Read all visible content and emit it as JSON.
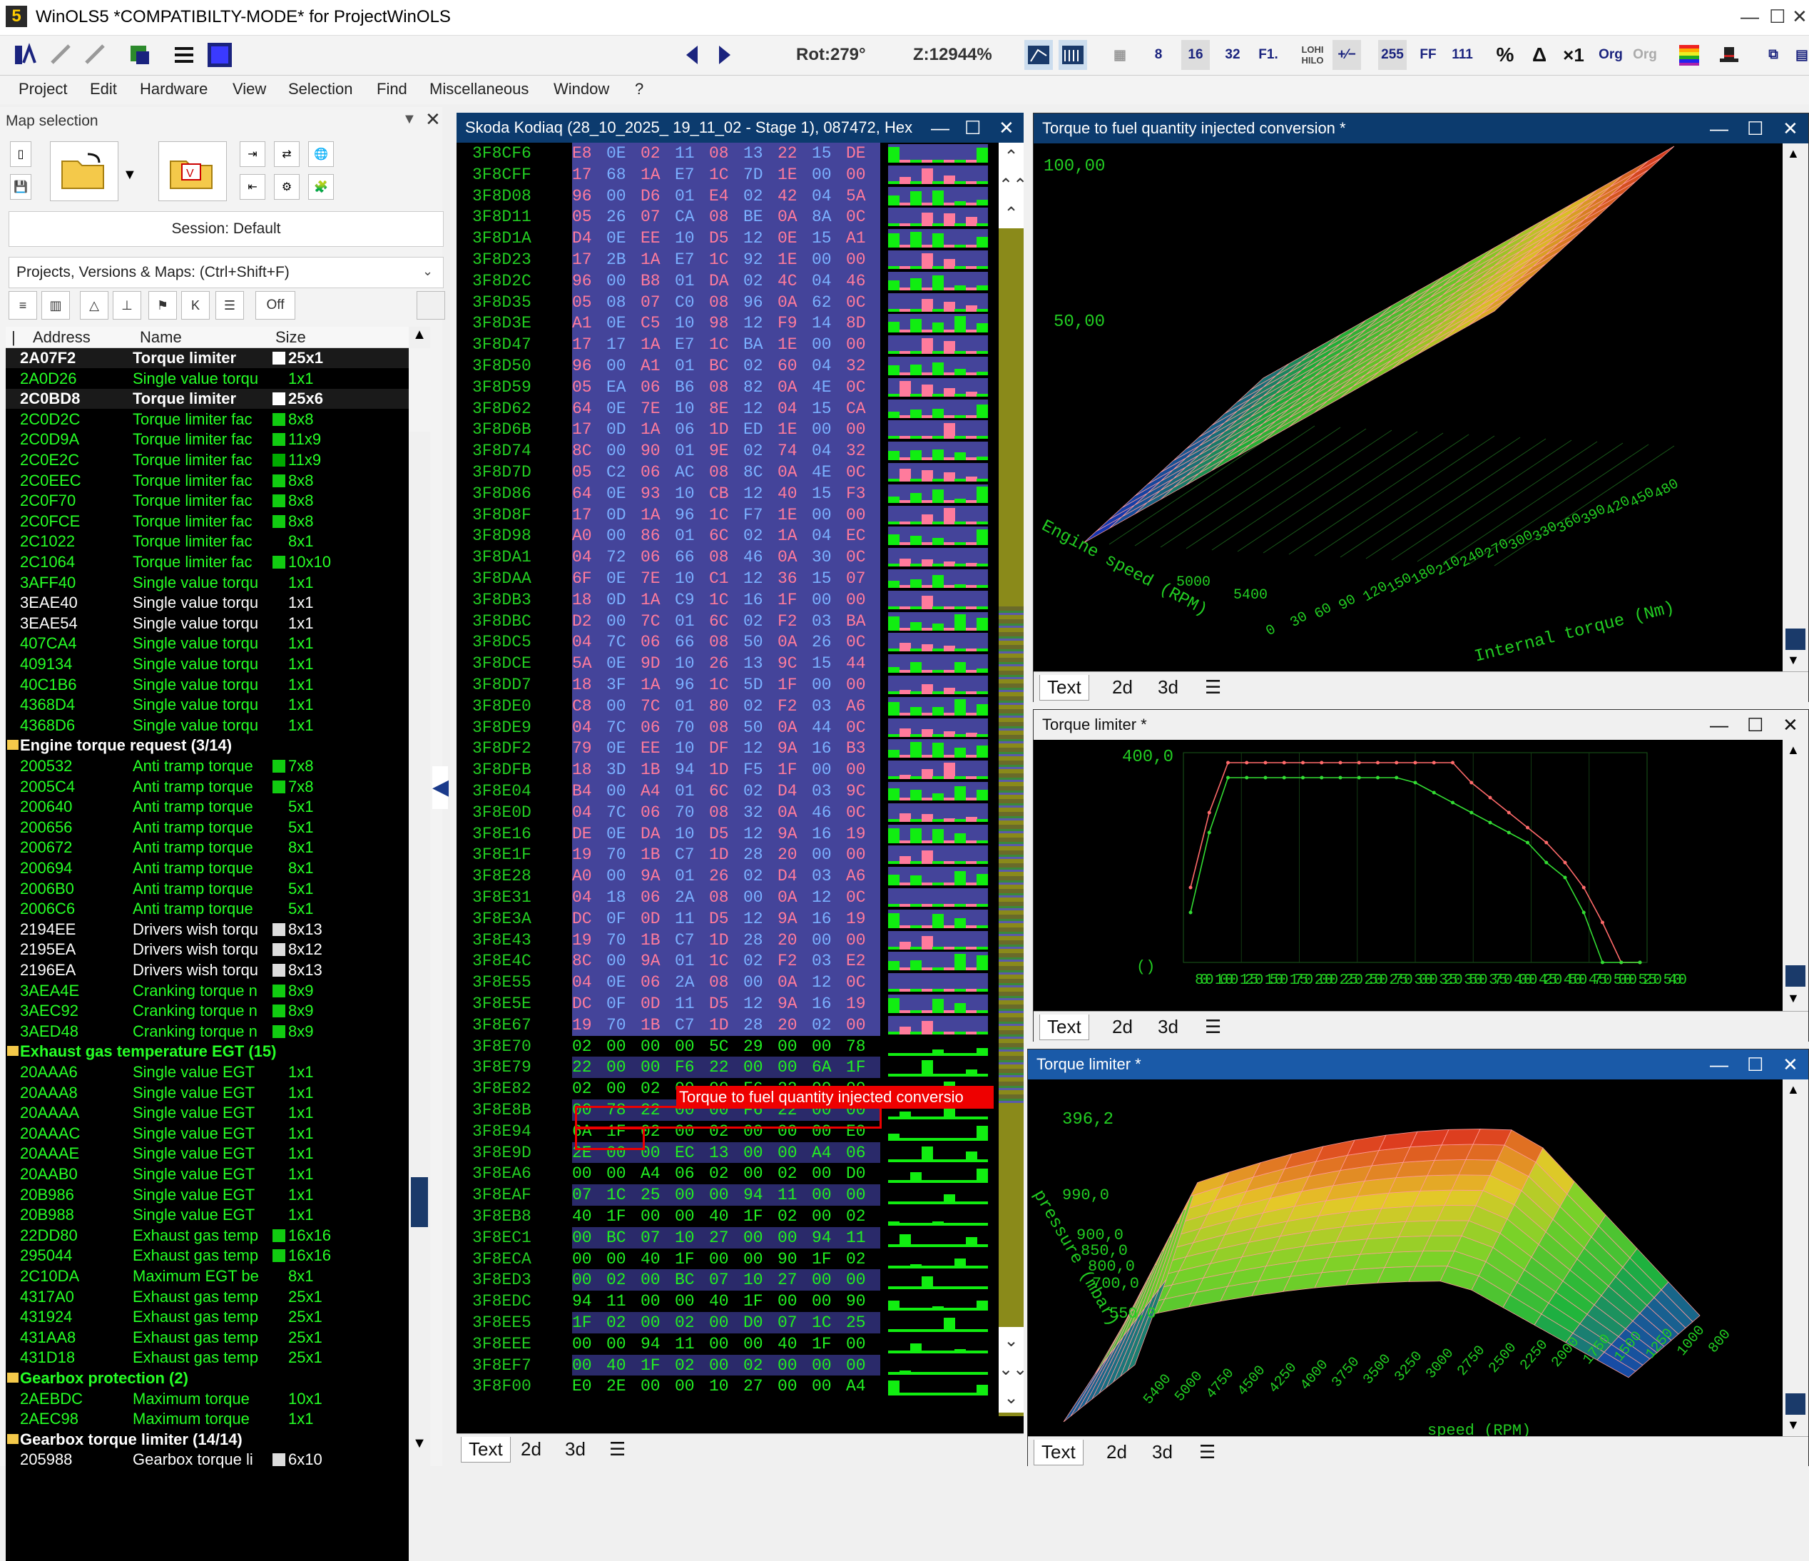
{
  "app": {
    "title": "WinOLS5 *COMPATIBILTY-MODE* for ProjectWinOLS",
    "logo": "5"
  },
  "toolbar": {
    "rot": "Rot:279°",
    "zoom": "Z:12944%",
    "btn8": "8",
    "btn16": "16",
    "btn32": "32",
    "btnf1": "F1.",
    "lohi": "LOHI",
    "hilo": "HILO",
    "b255": "255",
    "bff": "FF",
    "b111": "111",
    "pct": "%",
    "delta": "Δ",
    "x1": "×1",
    "org": "Org",
    "org2": "Org"
  },
  "menu": [
    "Project",
    "Edit",
    "Hardware",
    "View",
    "Selection",
    "Find",
    "Miscellaneous",
    "Window",
    "?"
  ],
  "map_selection": {
    "title": "Map selection",
    "session": "Session: Default",
    "search_placeholder": "Projects, Versions & Maps:  (Ctrl+Shift+F)",
    "off": "Off",
    "columns": {
      "address": "Address",
      "name": "Name",
      "size": "Size"
    },
    "rows": [
      {
        "t": "sel",
        "a": "2A07F2",
        "n": "Torque limiter",
        "s": "25x1",
        "sw": "#fff"
      },
      {
        "t": "g",
        "a": "2A0D26",
        "n": "Single value torqu",
        "s": "1x1"
      },
      {
        "t": "sel",
        "a": "2C0BD8",
        "n": "Torque limiter",
        "s": "25x6",
        "sw": "#fff"
      },
      {
        "t": "g",
        "a": "2C0D2C",
        "n": "Torque limiter fac",
        "s": "8x8",
        "sw": "#1c1"
      },
      {
        "t": "g",
        "a": "2C0D9A",
        "n": "Torque limiter fac",
        "s": "11x9",
        "sw": "#1c1"
      },
      {
        "t": "g",
        "a": "2C0E2C",
        "n": "Torque limiter fac",
        "s": "11x9",
        "sw": "#0a0"
      },
      {
        "t": "g",
        "a": "2C0EEC",
        "n": "Torque limiter fac",
        "s": "8x8",
        "sw": "#1c1"
      },
      {
        "t": "g",
        "a": "2C0F70",
        "n": "Torque limiter fac",
        "s": "8x8",
        "sw": "#1c1"
      },
      {
        "t": "g",
        "a": "2C0FCE",
        "n": "Torque limiter fac",
        "s": "8x8",
        "sw": "#1c1"
      },
      {
        "t": "g",
        "a": "2C1022",
        "n": "Torque limiter fac",
        "s": "8x1"
      },
      {
        "t": "g",
        "a": "2C1064",
        "n": "Torque limiter fac",
        "s": "10x10",
        "sw": "#1c1"
      },
      {
        "t": "g",
        "a": "3AFF40",
        "n": "Single value torqu",
        "s": "1x1"
      },
      {
        "t": "w",
        "a": "3EAE40",
        "n": "Single value torqu",
        "s": "1x1"
      },
      {
        "t": "w",
        "a": "3EAE54",
        "n": "Single value torqu",
        "s": "1x1"
      },
      {
        "t": "g",
        "a": "407CA4",
        "n": "Single value torqu",
        "s": "1x1"
      },
      {
        "t": "g",
        "a": "409134",
        "n": "Single value torqu",
        "s": "1x1"
      },
      {
        "t": "g",
        "a": "40C1B6",
        "n": "Single value torqu",
        "s": "1x1"
      },
      {
        "t": "g",
        "a": "4368D4",
        "n": "Single value torqu",
        "s": "1x1"
      },
      {
        "t": "g",
        "a": "4368D6",
        "n": "Single value torqu",
        "s": "1x1"
      },
      {
        "t": "grpw",
        "n": "Engine torque request (3/14)"
      },
      {
        "t": "g",
        "a": "200532",
        "n": "Anti tramp torque",
        "s": "7x8",
        "sw": "#1c1"
      },
      {
        "t": "g",
        "a": "2005C4",
        "n": "Anti tramp torque",
        "s": "7x8",
        "sw": "#1c1"
      },
      {
        "t": "g",
        "a": "200640",
        "n": "Anti tramp torque",
        "s": "5x1"
      },
      {
        "t": "g",
        "a": "200656",
        "n": "Anti tramp torque",
        "s": "5x1"
      },
      {
        "t": "g",
        "a": "200672",
        "n": "Anti tramp torque",
        "s": "8x1"
      },
      {
        "t": "g",
        "a": "200694",
        "n": "Anti tramp torque",
        "s": "8x1"
      },
      {
        "t": "g",
        "a": "2006B0",
        "n": "Anti tramp torque",
        "s": "5x1"
      },
      {
        "t": "g",
        "a": "2006C6",
        "n": "Anti tramp torque",
        "s": "5x1"
      },
      {
        "t": "w",
        "a": "2194EE",
        "n": "Drivers wish torqu",
        "s": "8x13",
        "sw": "#ddd"
      },
      {
        "t": "w",
        "a": "2195EA",
        "n": "Drivers wish torqu",
        "s": "8x12",
        "sw": "#ddd"
      },
      {
        "t": "w",
        "a": "2196EA",
        "n": "Drivers wish torqu",
        "s": "8x13",
        "sw": "#ddd"
      },
      {
        "t": "g",
        "a": "3AEA4E",
        "n": "Cranking torque n",
        "s": "8x9",
        "sw": "#1c1"
      },
      {
        "t": "g",
        "a": "3AEC92",
        "n": "Cranking torque n",
        "s": "8x9",
        "sw": "#1c1"
      },
      {
        "t": "g",
        "a": "3AED48",
        "n": "Cranking torque n",
        "s": "8x9",
        "sw": "#1c1"
      },
      {
        "t": "grp",
        "n": "Exhaust gas temperature EGT (15)"
      },
      {
        "t": "g",
        "a": "20AAA6",
        "n": "Single value EGT",
        "s": "1x1"
      },
      {
        "t": "g",
        "a": "20AAA8",
        "n": "Single value EGT",
        "s": "1x1"
      },
      {
        "t": "g",
        "a": "20AAAA",
        "n": "Single value EGT",
        "s": "1x1"
      },
      {
        "t": "g",
        "a": "20AAAC",
        "n": "Single value EGT",
        "s": "1x1"
      },
      {
        "t": "g",
        "a": "20AAAE",
        "n": "Single value EGT",
        "s": "1x1"
      },
      {
        "t": "g",
        "a": "20AAB0",
        "n": "Single value EGT",
        "s": "1x1"
      },
      {
        "t": "g",
        "a": "20B986",
        "n": "Single value EGT",
        "s": "1x1"
      },
      {
        "t": "g",
        "a": "20B988",
        "n": "Single value EGT",
        "s": "1x1"
      },
      {
        "t": "g",
        "a": "22DD80",
        "n": "Exhaust gas temp",
        "s": "16x16",
        "sw": "#1c1"
      },
      {
        "t": "g",
        "a": "295044",
        "n": "Exhaust gas temp",
        "s": "16x16",
        "sw": "#1c1"
      },
      {
        "t": "g",
        "a": "2C10DA",
        "n": "Maximum EGT be",
        "s": "8x1"
      },
      {
        "t": "g",
        "a": "4317A0",
        "n": "Exhaust gas temp",
        "s": "25x1"
      },
      {
        "t": "g",
        "a": "431924",
        "n": "Exhaust gas temp",
        "s": "25x1"
      },
      {
        "t": "g",
        "a": "431AA8",
        "n": "Exhaust gas temp",
        "s": "25x1"
      },
      {
        "t": "g",
        "a": "431D18",
        "n": "Exhaust gas temp",
        "s": "25x1"
      },
      {
        "t": "grp",
        "n": "Gearbox protection (2)"
      },
      {
        "t": "g",
        "a": "2AEBDC",
        "n": "Maximum torque",
        "s": "10x1"
      },
      {
        "t": "g",
        "a": "2AEC98",
        "n": "Maximum torque",
        "s": "1x1"
      },
      {
        "t": "grpw",
        "n": "Gearbox torque limiter (14/14)"
      },
      {
        "t": "w",
        "a": "205988",
        "n": "Gearbox torque li",
        "s": "6x10",
        "sw": "#ddd"
      }
    ]
  },
  "hex": {
    "title": "Skoda Kodiaq (28_10_2025_ 19_11_02 - Stage 1), 087472, Hex",
    "tooltip": "Torque to fuel quantity injected conversio",
    "tabs": [
      "Text",
      "2d",
      "3d"
    ],
    "rows": [
      {
        "a": "3F8CF6",
        "b": "E8 0E 02 11 08 13 22 15 DE"
      },
      {
        "a": "3F8CFF",
        "b": "17 68 1A E7 1C 7D 1E 00 00"
      },
      {
        "a": "3F8D08",
        "b": "96 00 D6 01 E4 02 42 04 5A"
      },
      {
        "a": "3F8D11",
        "b": "05 26 07 CA 08 BE 0A 8A 0C"
      },
      {
        "a": "3F8D1A",
        "b": "D4 0E EE 10 D5 12 0E 15 A1"
      },
      {
        "a": "3F8D23",
        "b": "17 2B 1A E7 1C 92 1E 00 00"
      },
      {
        "a": "3F8D2C",
        "b": "96 00 B8 01 DA 02 4C 04 46"
      },
      {
        "a": "3F8D35",
        "b": "05 08 07 C0 08 96 0A 62 0C"
      },
      {
        "a": "3F8D3E",
        "b": "A1 0E C5 10 98 12 F9 14 8D"
      },
      {
        "a": "3F8D47",
        "b": "17 17 1A E7 1C BA 1E 00 00"
      },
      {
        "a": "3F8D50",
        "b": "96 00 A1 01 BC 02 60 04 32"
      },
      {
        "a": "3F8D59",
        "b": "05 EA 06 B6 08 82 0A 4E 0C"
      },
      {
        "a": "3F8D62",
        "b": "64 0E 7E 10 8E 12 04 15 CA"
      },
      {
        "a": "3F8D6B",
        "b": "17 0D 1A 06 1D ED 1E 00 00"
      },
      {
        "a": "3F8D74",
        "b": "8C 00 90 01 9E 02 74 04 32"
      },
      {
        "a": "3F8D7D",
        "b": "05 C2 06 AC 08 8C 0A 4E 0C"
      },
      {
        "a": "3F8D86",
        "b": "64 0E 93 10 CB 12 40 15 F3"
      },
      {
        "a": "3F8D8F",
        "b": "17 0D 1A 96 1C F7 1E 00 00"
      },
      {
        "a": "3F8D98",
        "b": "A0 00 86 01 6C 02 1A 04 EC"
      },
      {
        "a": "3F8DA1",
        "b": "04 72 06 66 08 46 0A 30 0C"
      },
      {
        "a": "3F8DAA",
        "b": "6F 0E 7E 10 C1 12 36 15 07"
      },
      {
        "a": "3F8DB3",
        "b": "18 0D 1A C9 1C 16 1F 00 00"
      },
      {
        "a": "3F8DBC",
        "b": "D2 00 7C 01 6C 02 F2 03 BA"
      },
      {
        "a": "3F8DC5",
        "b": "04 7C 06 66 08 50 0A 26 0C"
      },
      {
        "a": "3F8DCE",
        "b": "5A 0E 9D 10 26 13 9C 15 44"
      },
      {
        "a": "3F8DD7",
        "b": "18 3F 1A 96 1C 5D 1F 00 00"
      },
      {
        "a": "3F8DE0",
        "b": "C8 00 7C 01 80 02 F2 03 A6"
      },
      {
        "a": "3F8DE9",
        "b": "04 7C 06 70 08 50 0A 44 0C"
      },
      {
        "a": "3F8DF2",
        "b": "79 0E EE 10 DF 12 9A 16 B3"
      },
      {
        "a": "3F8DFB",
        "b": "18 3D 1B 94 1D F5 1F 00 00"
      },
      {
        "a": "3F8E04",
        "b": "B4 00 A4 01 6C 02 D4 03 9C"
      },
      {
        "a": "3F8E0D",
        "b": "04 7C 06 70 08 32 0A 46 0C"
      },
      {
        "a": "3F8E16",
        "b": "DE 0E DA 10 D5 12 9A 16 19"
      },
      {
        "a": "3F8E1F",
        "b": "19 70 1B C7 1D 28 20 00 00"
      },
      {
        "a": "3F8E28",
        "b": "A0 00 9A 01 26 02 D4 03 A6"
      },
      {
        "a": "3F8E31",
        "b": "04 18 06 2A 08 00 0A 12 0C"
      },
      {
        "a": "3F8E3A",
        "b": "DC 0F 0D 11 D5 12 9A 16 19"
      },
      {
        "a": "3F8E43",
        "b": "19 70 1B C7 1D 28 20 00 00"
      },
      {
        "a": "3F8E4C",
        "b": "8C 00 9A 01 1C 02 F2 03 E2"
      },
      {
        "a": "3F8E55",
        "b": "04 0E 06 2A 08 00 0A 12 0C"
      },
      {
        "a": "3F8E5E",
        "b": "DC 0F 0D 11 D5 12 9A 16 19"
      },
      {
        "a": "3F8E67",
        "b": "19 70 1B C7 1D 28 20 02 00"
      },
      {
        "a": "3F8E70",
        "b": "02 00 00 00 5C 29 00 00 78"
      },
      {
        "a": "3F8E79",
        "b": "22 00 00 F6 22 00 00 6A 1F"
      },
      {
        "a": "3F8E82",
        "b": "02 00 02 00 00 F6 22 00 00"
      },
      {
        "a": "3F8E8B",
        "b": "00 78 22 00 00 F6 22 00 00"
      },
      {
        "a": "3F8E94",
        "b": "6A 1F 02 00 02 00 00 00 E0"
      },
      {
        "a": "3F8E9D",
        "b": "2E 00 00 EC 13 00 00 A4 06"
      },
      {
        "a": "3F8EA6",
        "b": "00 00 A4 06 02 00 02 00 D0"
      },
      {
        "a": "3F8EAF",
        "b": "07 1C 25 00 00 94 11 00 00"
      },
      {
        "a": "3F8EB8",
        "b": "40 1F 00 00 40 1F 02 00 02"
      },
      {
        "a": "3F8EC1",
        "b": "00 BC 07 10 27 00 00 94 11"
      },
      {
        "a": "3F8ECA",
        "b": "00 00 40 1F 00 00 90 1F 02"
      },
      {
        "a": "3F8ED3",
        "b": "00 02 00 BC 07 10 27 00 00"
      },
      {
        "a": "3F8EDC",
        "b": "94 11 00 00 40 1F 00 00 90"
      },
      {
        "a": "3F8EE5",
        "b": "1F 02 00 02 00 D0 07 1C 25"
      },
      {
        "a": "3F8EEE",
        "b": "00 00 94 11 00 00 40 1F 00"
      },
      {
        "a": "3F8EF7",
        "b": "00 40 1F 02 00 02 00 00 00"
      },
      {
        "a": "3F8F00",
        "b": "E0 2E 00 00 10 27 00 00 A4"
      }
    ]
  },
  "chart_data": [
    {
      "type": "surface3d",
      "title": "Torque to fuel quantity injected conversion *",
      "zlabel_values": [
        "100,00",
        "50,00"
      ],
      "xlabel": "Engine speed (RPM)",
      "ylabel": "Internal torque (Nm)",
      "y_ticks": [
        "0",
        "30",
        "60",
        "90",
        "120",
        "150",
        "180",
        "210",
        "240",
        "270",
        "300",
        "330",
        "360",
        "390",
        "420",
        "450",
        "480"
      ],
      "x_ticks": [
        "5000",
        "5400"
      ]
    },
    {
      "type": "line",
      "title": "Torque limiter *",
      "y_label_top": "400,0",
      "y_label_bottom": "()",
      "x_tick_text": "800 1000 1250 1500 1750 2000 2250 2500 2750 3000 3250 3500 3750 4000 4250 4500 4750 5000 5250 5400",
      "series": [
        {
          "values": [
            150,
            300,
            400,
            400,
            400,
            400,
            400,
            400,
            400,
            400,
            400,
            400,
            400,
            400,
            400,
            360,
            330,
            300,
            270,
            240,
            200,
            150,
            80,
            0,
            0
          ]
        },
        {
          "values": [
            100,
            260,
            370,
            370,
            370,
            370,
            370,
            370,
            370,
            370,
            370,
            370,
            360,
            340,
            320,
            300,
            280,
            260,
            240,
            200,
            170,
            100,
            0,
            0,
            0
          ]
        }
      ],
      "ylim": [
        0,
        420
      ]
    },
    {
      "type": "surface3d",
      "title": "Torque limiter *",
      "zlabel_values": [
        "396,2"
      ],
      "pressure_ticks": [
        "990,0",
        "900,0",
        "850,0",
        "800,0",
        "700,0",
        "550,0"
      ],
      "ylabel": "pressure (mbar)",
      "xlabel": "speed (RPM)",
      "x_ticks": [
        "5400",
        "5000",
        "4750",
        "4500",
        "4250",
        "4000",
        "3750",
        "3500",
        "3250",
        "3000",
        "2750",
        "2500",
        "2250",
        "2000",
        "1750",
        "1500",
        "1250",
        "1000",
        "800"
      ]
    }
  ],
  "chart_tabs": [
    "Text",
    "2d",
    "3d"
  ],
  "colors": {
    "title_blue": "#0c3b6e",
    "list_green": "#26ff26",
    "hex_purple": "#44449a",
    "hex_text_pink": "#ff7b9c",
    "hex_text_green": "#22ee22"
  }
}
